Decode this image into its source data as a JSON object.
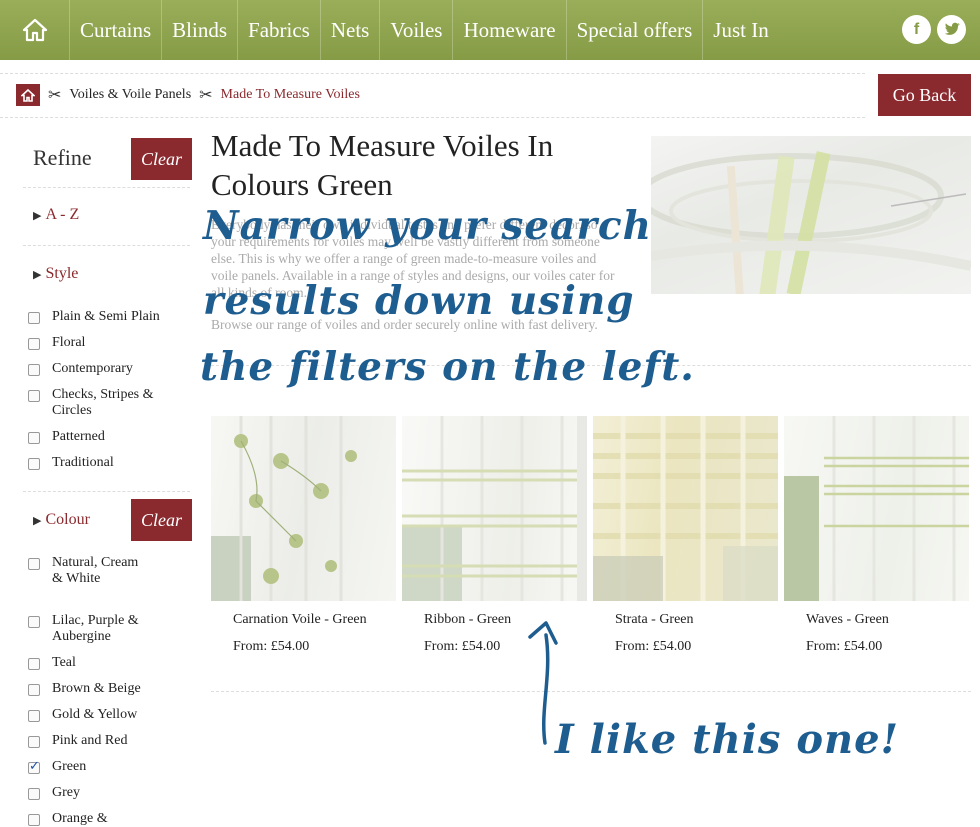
{
  "nav": {
    "items": [
      "Curtains",
      "Blinds",
      "Fabrics",
      "Nets",
      "Voiles",
      "Homeware",
      "Special offers",
      "Just In"
    ],
    "social": [
      "f",
      "t"
    ]
  },
  "breadcrumb": {
    "parent": "Voiles & Voile Panels",
    "current": "Made To Measure Voiles"
  },
  "go_back": "Go Back",
  "sidebar": {
    "refine": "Refine",
    "clear": "Clear",
    "az": "A - Z",
    "style_title": "Style",
    "style_options": [
      {
        "label": "Plain & Semi Plain",
        "checked": false
      },
      {
        "label": "Floral",
        "checked": false
      },
      {
        "label": "Contemporary",
        "checked": false
      },
      {
        "label": "Checks, Stripes & Circles",
        "checked": false
      },
      {
        "label": "Patterned",
        "checked": false
      },
      {
        "label": "Traditional",
        "checked": false
      }
    ],
    "colour_title": "Colour",
    "colour_clear": "Clear",
    "colour_options": [
      {
        "label": "Natural, Cream & White",
        "checked": false
      },
      {
        "label": "Lilac, Purple & Aubergine",
        "checked": false
      },
      {
        "label": "Teal",
        "checked": false
      },
      {
        "label": "Brown & Beige",
        "checked": false
      },
      {
        "label": "Gold & Yellow",
        "checked": false
      },
      {
        "label": "Pink and Red",
        "checked": false
      },
      {
        "label": "Green",
        "checked": true
      },
      {
        "label": "Grey",
        "checked": false
      },
      {
        "label": "Orange & Terracotta",
        "checked": false
      }
    ]
  },
  "main": {
    "title": "Made To Measure Voiles In Colours Green",
    "intro_1": "Everybody has their own individual tastes and prefer different decor, so your requirements for voiles may well be vastly different from someone else. This is why we offer a range of green made-to-measure voiles and voile panels. Available in a range of styles and designs, our voiles cater for all kinds of room.",
    "intro_2": "Browse our range of voiles and order securely online with fast delivery.",
    "products": [
      {
        "name": "Carnation Voile - Green",
        "price": "From: £54.00"
      },
      {
        "name": "Ribbon - Green",
        "price": "From: £54.00"
      },
      {
        "name": "Strata - Green",
        "price": "From: £54.00"
      },
      {
        "name": "Waves - Green",
        "price": "From: £54.00"
      }
    ]
  },
  "annotations": {
    "line1": "Narrow your search",
    "line2": "results down using",
    "line3": "the filters on the left.",
    "like": "I like this one!"
  },
  "colors": {
    "nav_green": "#869b45",
    "brand_red": "#8b2a2e",
    "annotation_blue": "#1e5d8f"
  }
}
